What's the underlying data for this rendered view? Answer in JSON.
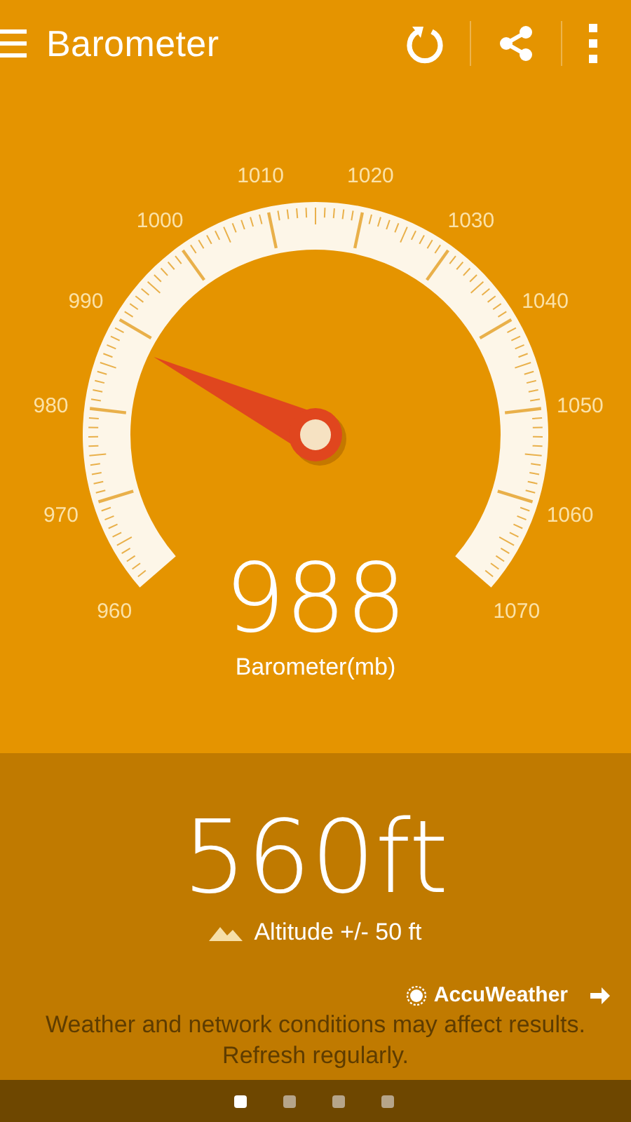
{
  "app_bar": {
    "title": "Barometer"
  },
  "gauge": {
    "scale_labels": [
      "960",
      "970",
      "980",
      "990",
      "1000",
      "1010",
      "1020",
      "1030",
      "1040",
      "1050",
      "1060",
      "1070"
    ],
    "reading": "988",
    "unit_label": "Barometer(mb)"
  },
  "altitude": {
    "value": "560ft",
    "accuracy": "Altitude +/- 50 ft"
  },
  "provider": {
    "name": "AccuWeather"
  },
  "disclaimer_lines": [
    "Weather and network conditions may affect results.",
    "Refresh regularly."
  ],
  "pages": [
    {
      "selected": true
    },
    {
      "selected": false
    },
    {
      "selected": false
    },
    {
      "selected": false
    }
  ]
}
